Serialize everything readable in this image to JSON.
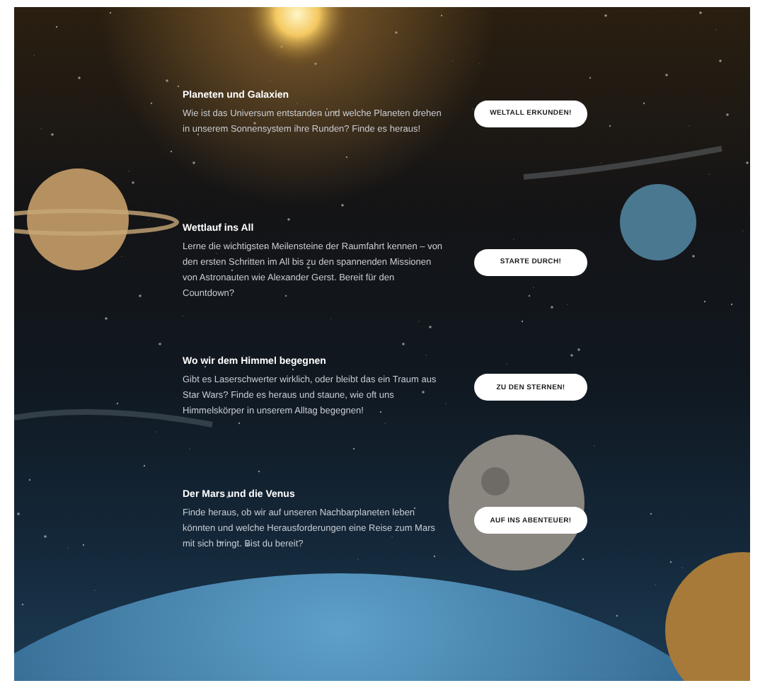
{
  "sections": [
    {
      "title": "Planeten und Galaxien",
      "text": "Wie ist das Universum entstanden und welche Planeten drehen in unserem Sonnensystem ihre Runden? Finde es heraus!",
      "button": "WELTALL ERKUNDEN!"
    },
    {
      "title": "Wettlauf ins All",
      "text": "Lerne die wichtigsten Meilensteine der Raumfahrt kennen – von den ersten Schritten im All bis zu den spannenden Missionen von Astronauten wie Alexander Gerst. Bereit für den Countdown?",
      "button": "STARTE DURCH!"
    },
    {
      "title": "Wo wir dem Himmel begegnen",
      "text": "Gibt es Laserschwerter wirklich, oder bleibt das ein Traum aus Star Wars? Finde es heraus und staune, wie oft uns Himmelskörper in unserem Alltag begegnen!",
      "button": "ZU DEN STERNEN!"
    },
    {
      "title": "Der Mars und die Venus",
      "text": "Finde heraus, ob wir auf unseren Nachbarplaneten leben könnten und welche Herausforderungen eine Reise zum Mars mit sich bringt. Bist du bereit?",
      "button": "AUF INS ABENTEUER!"
    }
  ]
}
